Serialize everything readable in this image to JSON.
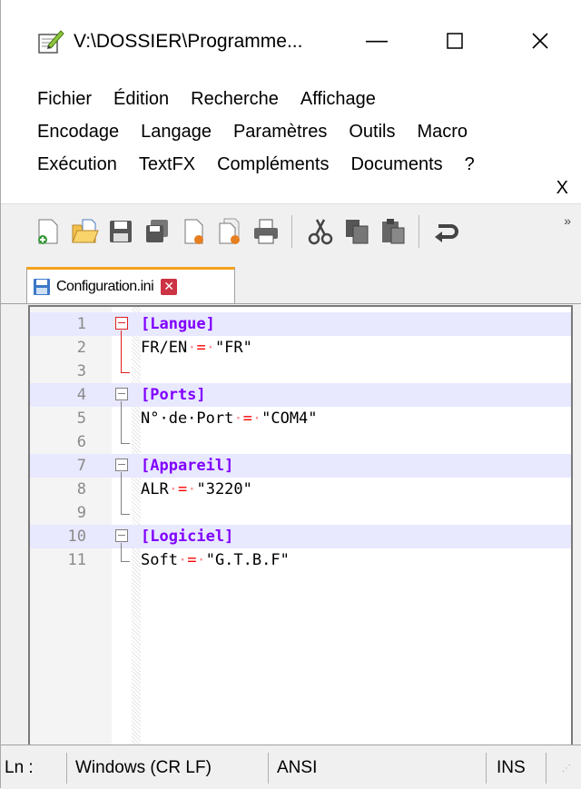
{
  "window": {
    "title": "V:\\DOSSIER\\Programme...",
    "minimize": "—",
    "maximize": "☐",
    "close": "✕"
  },
  "menu": {
    "row1": [
      "Fichier",
      "Édition",
      "Recherche",
      "Affichage"
    ],
    "row2": [
      "Encodage",
      "Langage",
      "Paramètres",
      "Outils",
      "Macro"
    ],
    "row3": [
      "Exécution",
      "TextFX",
      "Compléments",
      "Documents",
      "?"
    ],
    "close": "X"
  },
  "toolbar": {
    "icons": [
      "new-file-icon",
      "open-file-icon",
      "save-icon",
      "save-all-icon",
      "close-icon",
      "close-all-icon",
      "print-icon",
      "cut-icon",
      "copy-icon",
      "paste-icon",
      "undo-icon"
    ],
    "more": "»"
  },
  "tab": {
    "label": "Configuration.ini",
    "close": "✕"
  },
  "editor": {
    "lines": [
      {
        "n": "1",
        "section": "[Langue]"
      },
      {
        "n": "2",
        "key": "FR/EN",
        "value": "\"FR\""
      },
      {
        "n": "3"
      },
      {
        "n": "4",
        "section": "[Ports]"
      },
      {
        "n": "5",
        "key": "N°·de·Port",
        "value": "\"COM4\""
      },
      {
        "n": "6"
      },
      {
        "n": "7",
        "section": "[Appareil]"
      },
      {
        "n": "8",
        "key": "ALR",
        "value": "\"3220\""
      },
      {
        "n": "9"
      },
      {
        "n": "10",
        "section": "[Logiciel]"
      },
      {
        "n": "11",
        "key": "Soft",
        "value": "\"G.T.B.F\""
      }
    ]
  },
  "status": {
    "ln": "Ln :",
    "eol": "Windows (CR LF)",
    "encoding": "ANSI",
    "mode": "INS"
  },
  "colors": {
    "section": "#8000ff",
    "operator": "#ff0000",
    "fold_active": "#e02020",
    "tab_accent": "#f5a21c"
  }
}
